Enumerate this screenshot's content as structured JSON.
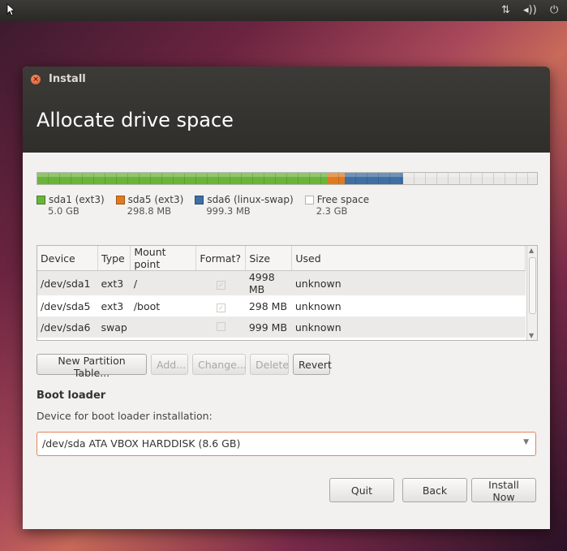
{
  "panel": {
    "indicators": [
      "⇅",
      "◂))",
      "⏻"
    ]
  },
  "window": {
    "title": "Install",
    "heading": "Allocate drive space"
  },
  "partition_bar": {
    "segments": [
      {
        "name": "sda1",
        "fraction": 0.581,
        "color": "#6ab539"
      },
      {
        "name": "sda5",
        "fraction": 0.035,
        "color": "#e07a1f"
      },
      {
        "name": "sda6",
        "fraction": 0.116,
        "color": "#3f6fa3"
      },
      {
        "name": "free",
        "fraction": 0.268,
        "color": "#e8e7e5"
      }
    ]
  },
  "legend": [
    {
      "label": "sda1 (ext3)",
      "size": "5.0 GB",
      "color": "#6ab539"
    },
    {
      "label": "sda5 (ext3)",
      "size": "298.8 MB",
      "color": "#e07a1f"
    },
    {
      "label": "sda6 (linux-swap)",
      "size": "999.3 MB",
      "color": "#3f6fa3"
    },
    {
      "label": "Free space",
      "size": "2.3 GB",
      "color": "#ffffff"
    }
  ],
  "table": {
    "headers": [
      "Device",
      "Type",
      "Mount point",
      "Format?",
      "Size",
      "Used"
    ],
    "rows": [
      {
        "device": "/dev/sda1",
        "type": "ext3",
        "mount": "/",
        "format": "✓",
        "size": "4998 MB",
        "used": "unknown"
      },
      {
        "device": "/dev/sda5",
        "type": "ext3",
        "mount": "/boot",
        "format": "✓",
        "size": "298 MB",
        "used": "unknown"
      },
      {
        "device": "/dev/sda6",
        "type": "swap",
        "mount": "",
        "format": "",
        "size": "999 MB",
        "used": "unknown"
      }
    ]
  },
  "buttons": {
    "new_partition_table": "New Partition Table...",
    "add": "Add...",
    "change": "Change...",
    "delete": "Delete",
    "revert": "Revert",
    "quit": "Quit",
    "back": "Back",
    "install_now": "Install Now"
  },
  "boot_loader": {
    "title": "Boot loader",
    "description": "Device for boot loader installation:",
    "selected": "/dev/sda ATA VBOX HARDDISK (8.6 GB)"
  }
}
